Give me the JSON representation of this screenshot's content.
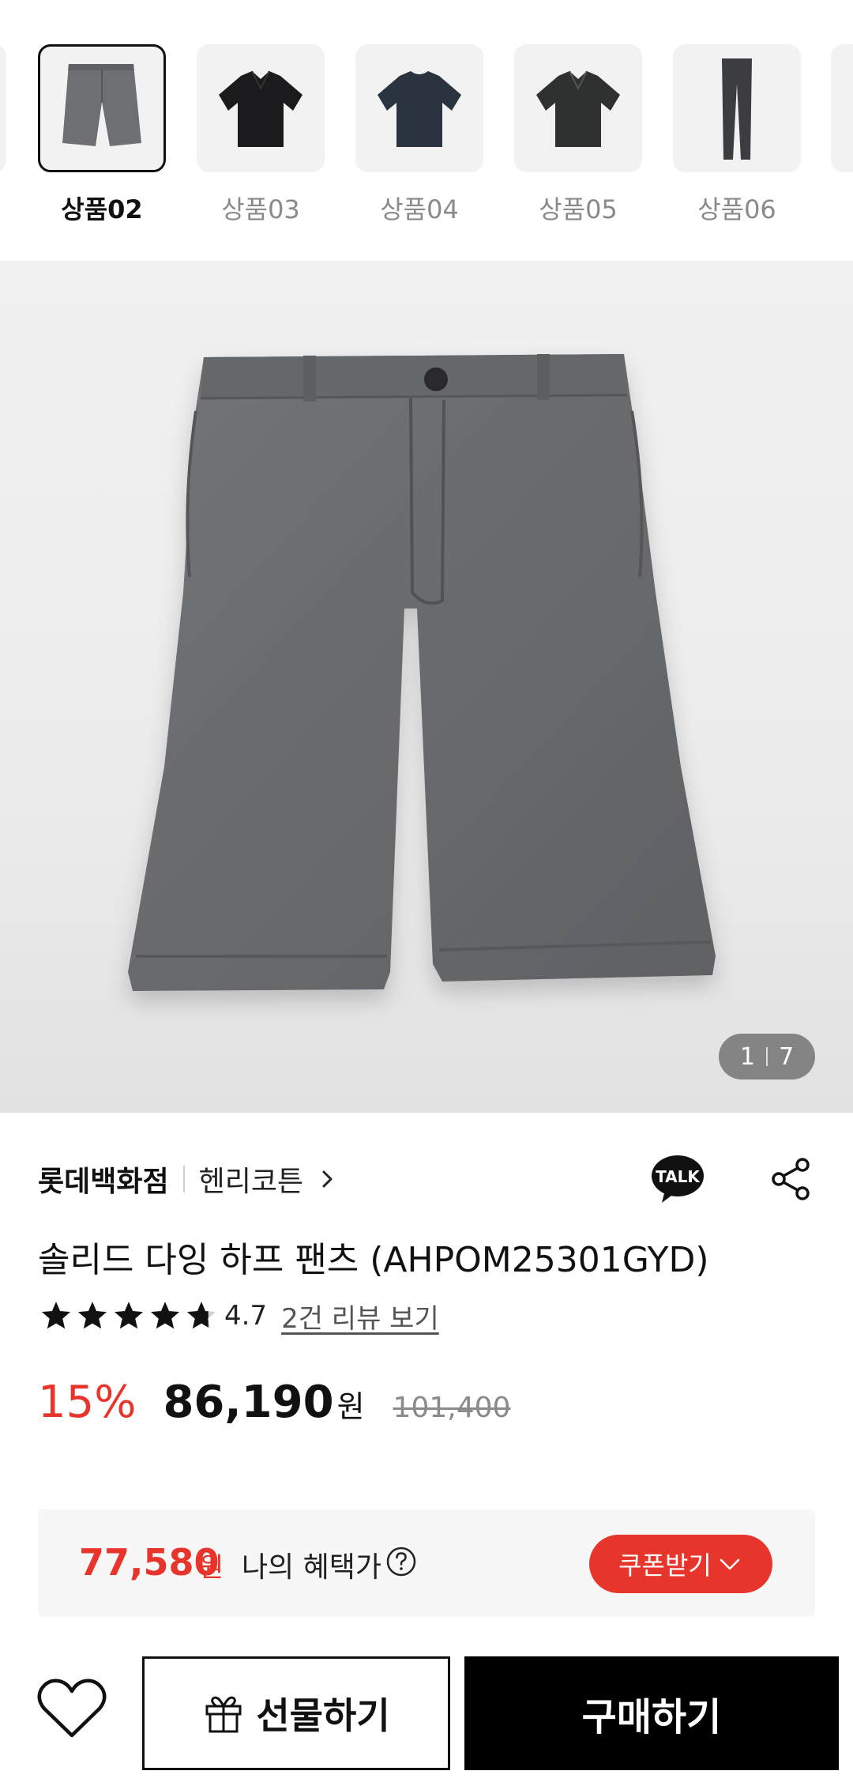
{
  "thumbnails": [
    {
      "label": "상품02",
      "active": true,
      "kind": "shorts"
    },
    {
      "label": "상품03",
      "active": false,
      "kind": "polo-black"
    },
    {
      "label": "상품04",
      "active": false,
      "kind": "tee-navy"
    },
    {
      "label": "상품05",
      "active": false,
      "kind": "polo-charcoal"
    },
    {
      "label": "상품06",
      "active": false,
      "kind": "trousers"
    }
  ],
  "gallery": {
    "current": "1",
    "total": "7"
  },
  "product": {
    "store": "롯데백화점",
    "brand": "헨리코튼",
    "title": "솔리드 다잉 하프 팬츠 (AHPOM25301GYD)",
    "rating": 4.7,
    "rating_text": "4.7",
    "review_link": "2건 리뷰 보기",
    "discount": "15%",
    "price": "86,190",
    "currency": "원",
    "original_price": "101,400"
  },
  "benefit": {
    "price": "77,580",
    "currency": "원",
    "label": "나의 혜택가",
    "coupon_label": "쿠폰받기"
  },
  "actions": {
    "gift_label": "선물하기",
    "buy_label": "구매하기"
  },
  "icons": {
    "talk": "kakao-talk-icon",
    "share": "share-icon",
    "wish": "heart-icon",
    "gift": "gift-icon",
    "help": "question-icon"
  },
  "colors": {
    "accent": "#e8352b",
    "primary": "#111111",
    "product_gray": "#6b6d70"
  }
}
